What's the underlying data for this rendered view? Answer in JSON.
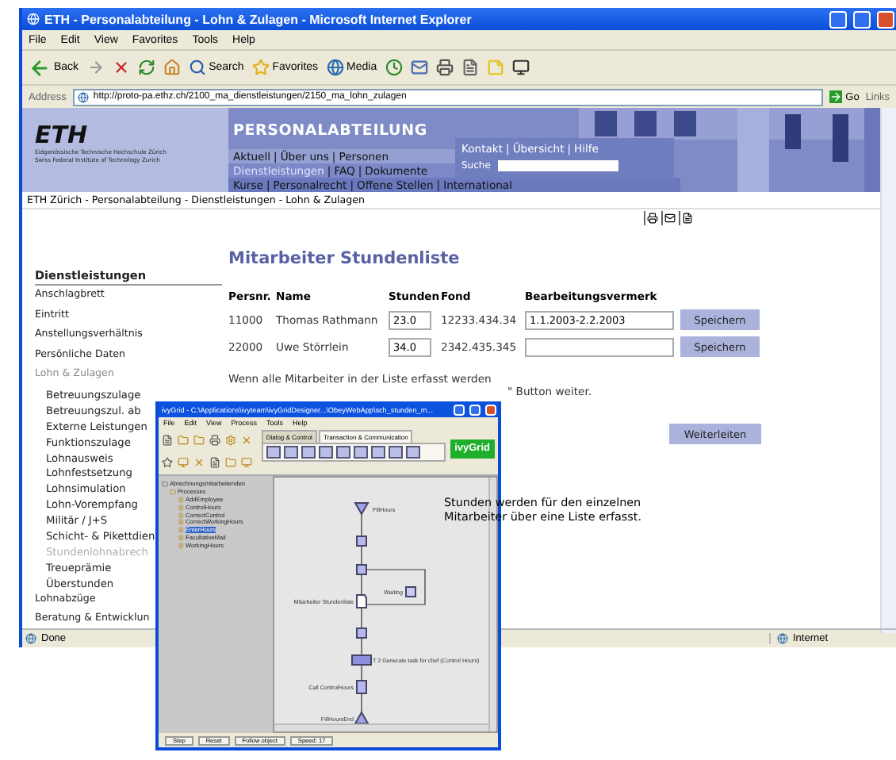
{
  "browser": {
    "title": "ETH - Personalabteilung - Lohn & Zulagen - Microsoft Internet Explorer",
    "menu": [
      "File",
      "Edit",
      "View",
      "Favorites",
      "Tools",
      "Help"
    ],
    "toolbar": [
      {
        "kind": "back",
        "label": "Back"
      },
      {
        "kind": "forward"
      },
      {
        "kind": "stop"
      },
      {
        "kind": "refresh"
      },
      {
        "kind": "home"
      },
      {
        "kind": "search",
        "label": "Search"
      },
      {
        "kind": "favorites",
        "label": "Favorites"
      },
      {
        "kind": "media",
        "label": "Media"
      },
      {
        "kind": "history"
      },
      {
        "kind": "mail"
      },
      {
        "kind": "print"
      },
      {
        "kind": "edit"
      },
      {
        "kind": "note"
      },
      {
        "kind": "messenger"
      }
    ],
    "address_label": "Address",
    "url": "http://proto-pa.ethz.ch/2100_ma_dienstleistungen/2150_ma_lohn_zulagen",
    "go": "Go",
    "links": "Links"
  },
  "header": {
    "logo": "ETH",
    "logo_lines": [
      "Eidgenössische Technische Hochschule Zürich",
      "Swiss Federal Institute of Technology Zurich"
    ],
    "site_title": "PERSONALABTEILUNG",
    "separator": "|",
    "nav_rows": [
      [
        {
          "label": "Aktuell",
          "selected": false
        },
        {
          "label": "Über uns",
          "selected": false
        },
        {
          "label": "Personen",
          "selected": false
        }
      ],
      [
        {
          "label": "Dienstleistungen",
          "selected": true
        },
        {
          "label": "FAQ",
          "selected": false
        },
        {
          "label": "Dokumente",
          "selected": false
        }
      ],
      [
        {
          "label": "Kurse",
          "selected": false
        },
        {
          "label": "Personalrecht",
          "selected": false
        },
        {
          "label": "Offene Stellen",
          "selected": false
        },
        {
          "label": "International",
          "selected": false
        }
      ]
    ],
    "utility_links": [
      "Kontakt",
      "Übersicht",
      "Hilfe"
    ],
    "search_label": "Suche"
  },
  "breadcrumb": "ETH Zürich - Personalabteilung - Dienstleistungen - Lohn & Zulagen",
  "sidebar": {
    "heading": "Dienstleistungen",
    "items": [
      {
        "label": "Anschlagbrett",
        "selected": false,
        "expanded": false
      },
      {
        "label": "Eintritt",
        "selected": false,
        "expanded": false
      },
      {
        "label": "Anstellungsverhältnis",
        "selected": false,
        "expanded": false
      },
      {
        "label": "Persönliche Daten",
        "selected": false,
        "expanded": false
      },
      {
        "label": "Lohn & Zulagen",
        "selected": false,
        "expanded": true,
        "children": [
          {
            "label": "Betreuungszulage",
            "selected": false
          },
          {
            "label": "Betreuungszul. ab",
            "selected": false
          },
          {
            "label": "Externe Leistungen",
            "selected": false
          },
          {
            "label": "Funktionszulage",
            "selected": false
          },
          {
            "label": "Lohnausweis",
            "selected": false
          },
          {
            "label": "Lohnfestsetzung",
            "selected": false
          },
          {
            "label": "Lohnsimulation",
            "selected": false
          },
          {
            "label": "Lohn-Vorempfang",
            "selected": false
          },
          {
            "label": "Militär / J+S",
            "selected": false
          },
          {
            "label": "Schicht- & Pikettdien",
            "selected": false
          },
          {
            "label": "Stundenlohnabrech",
            "selected": true
          },
          {
            "label": "Treueprämie",
            "selected": false
          },
          {
            "label": "Überstunden",
            "selected": false
          }
        ]
      },
      {
        "label": "Lohnabzüge",
        "selected": false,
        "expanded": false
      },
      {
        "label": "Beratung & Entwicklun",
        "selected": false,
        "expanded": false
      }
    ]
  },
  "page": {
    "heading": "Mitarbeiter Stundenliste",
    "columns": [
      "Persnr.",
      "Name",
      "Stunden",
      "Fond",
      "Bearbeitungsvermerk"
    ],
    "rows": [
      {
        "persnr": "11000",
        "name": "Thomas Rathmann",
        "stunden": "23.0",
        "fond": "12233.434.34",
        "vermerk": "1.1.2003-2.2.2003",
        "button": "Speichern"
      },
      {
        "persnr": "22000",
        "name": "Uwe Störrlein",
        "stunden": "34.0",
        "fond": "2342.435.345",
        "button": "Speichern"
      }
    ],
    "paragraph": "Wenn alle Mitarbeiter in der Liste erfasst werden",
    "paragraph_end": "\" Button weiter.",
    "button": "Weiterleiten"
  },
  "note": "Stunden werden für den einzelnen\nMitarbeiter über eine Liste erfasst.",
  "status_bar": {
    "text": "Done",
    "zone": "Internet"
  },
  "ivy": {
    "title": "ivyGrid - C:\\Applications\\ivyteam\\ivyGridDesigner...\\ObeyWebApp\\sch_stunden_m...",
    "menu": [
      "File",
      "Edit",
      "View",
      "Process",
      "Tools",
      "Help"
    ],
    "palette_tabs": [
      {
        "label": "Dialog & Control",
        "selected": false
      },
      {
        "label": "Transaction & Communication",
        "selected": true
      }
    ],
    "logo": "ivyGrid",
    "tree": {
      "root": "Abrechnungsmitarbeitenden",
      "folder": "Processes",
      "items": [
        {
          "label": "AddEmployee",
          "selected": false
        },
        {
          "label": "ControlHours",
          "selected": false
        },
        {
          "label": "CorrectControl",
          "selected": false
        },
        {
          "label": "CorrectWorkingHours",
          "selected": false
        },
        {
          "label": "EnterHours",
          "selected": true
        },
        {
          "label": "FacultativeMail",
          "selected": false
        },
        {
          "label": "WorkingHours",
          "selected": false
        }
      ]
    },
    "nodes": [
      {
        "kind": "start",
        "label": "FillHours"
      },
      {
        "kind": "step"
      },
      {
        "kind": "step"
      },
      {
        "kind": "wait",
        "label": "Waiting"
      },
      {
        "kind": "page",
        "label": "Mitarbeiter Stundenliste"
      },
      {
        "kind": "step"
      },
      {
        "kind": "task",
        "label": "T 2 Generate task for chef (Control Hours)"
      },
      {
        "kind": "call",
        "label": "Call ControlHours"
      },
      {
        "kind": "end",
        "label": "FillHoursEnd"
      }
    ],
    "controls": [
      "Step",
      "Reset",
      "Follow object",
      "Speed: 17"
    ]
  }
}
